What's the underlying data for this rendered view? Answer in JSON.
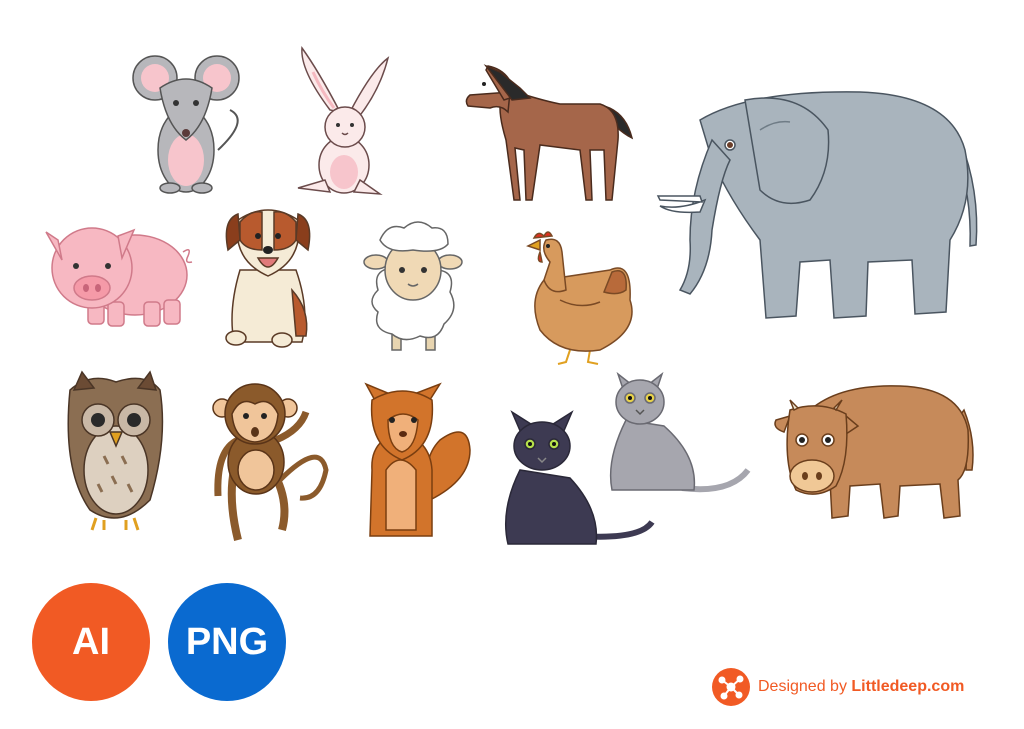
{
  "badges": {
    "ai": {
      "label": "AI",
      "color": "#f15a24"
    },
    "png": {
      "label": "PNG",
      "color": "#0a6ad0"
    }
  },
  "credit": {
    "prefix": "Designed by",
    "brand": "Littledeep.com",
    "color": "#f15a24",
    "icon": "molecule-logo-icon"
  },
  "animals": [
    "mouse",
    "rabbit",
    "horse",
    "elephant",
    "pig",
    "dog",
    "sheep",
    "chicken",
    "owl",
    "monkey",
    "squirrel",
    "black-cat",
    "gray-cat",
    "bull"
  ],
  "palette": {
    "orange": "#f15a24",
    "blue": "#0a6ad0",
    "elephant_gray": "#a9b4bd",
    "pig_pink": "#f7b8c2",
    "horse_brown": "#a5664a"
  }
}
